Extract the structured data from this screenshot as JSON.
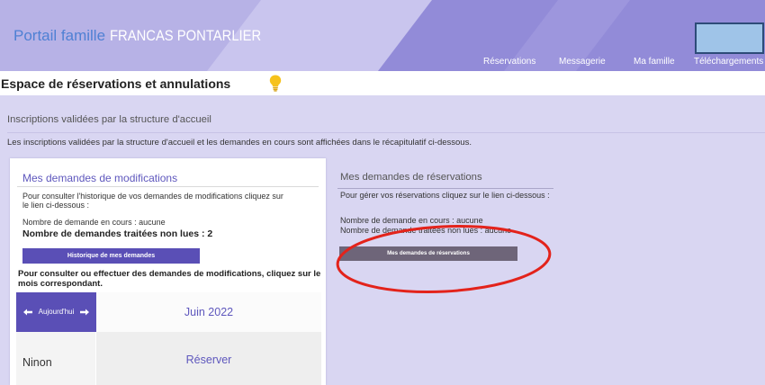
{
  "header": {
    "title_prefix": "Portail famille",
    "title_org": "FRANCAS PONTARLIER",
    "nav": [
      "Réservations",
      "Messagerie",
      "Ma famille",
      "Téléchargements"
    ]
  },
  "page": {
    "title": "Espace de réservations et annulations",
    "title_icon": "lightbulb-icon"
  },
  "inscriptions": {
    "heading": "Inscriptions validées par la structure d'accueil",
    "info": "Les inscriptions validées par la structure d'accueil et les demandes en cours  sont affichées dans le récapitulatif ci-dessous."
  },
  "modifications": {
    "heading": "Mes demandes de modifications",
    "history_intro": "Pour consulter l'historique de vos demandes de modifications cliquez sur le lien ci-dessous :",
    "pending": "Nombre de demande en cours : aucune",
    "unread": "Nombre de demandes traitées non lues : 2",
    "history_button": "Historique de mes demandes",
    "month_intro": "Pour consulter ou effectuer des demandes de modifications, cliquez sur le mois correspondant.",
    "calendar": {
      "prev_icon": "arrow-left-icon",
      "today_label": "Aujourd'hui",
      "next_icon": "arrow-right-icon",
      "month": "Juin 2022",
      "rows": [
        {
          "child": "Ninon",
          "action": "Réserver"
        }
      ]
    }
  },
  "reservations": {
    "heading": "Mes demandes de réservations",
    "intro": "Pour gérer vos réservations cliquez sur le lien ci-dessous :",
    "pending": "Nombre de demande en cours : aucune",
    "unread": "Nombre de demande traitées non lues : aucune",
    "button": "Mes demandes de réservations"
  },
  "colors": {
    "accent": "#5a4fb6",
    "accent_text": "#5e57bd",
    "page_background": "#d9d6f2",
    "reservations_button": "#6e6579",
    "annotation": "#e3231b",
    "title_prefix": "#4f80d4"
  }
}
